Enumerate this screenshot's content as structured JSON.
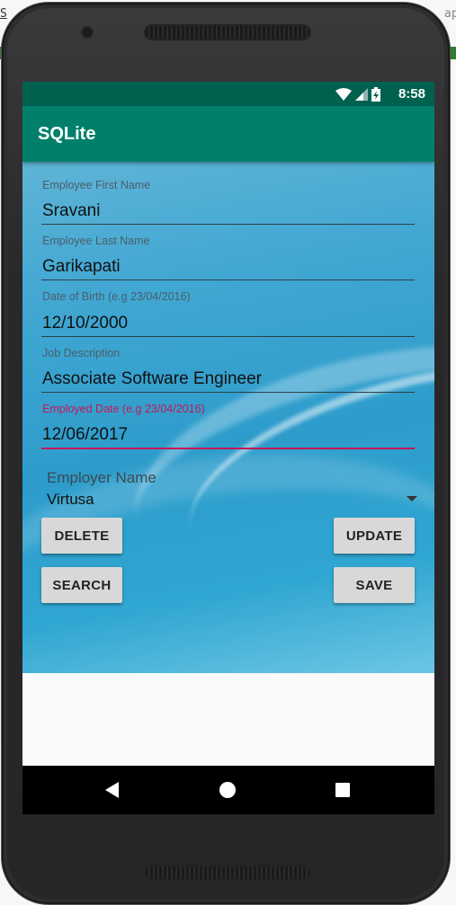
{
  "status_bar": {
    "time": "8:58",
    "icons": [
      "wifi-icon",
      "signal-icon",
      "battery-charging-icon"
    ]
  },
  "app_bar": {
    "title": "SQLite"
  },
  "form": {
    "first_name": {
      "label": "Employee First Name",
      "value": "Sravani"
    },
    "last_name": {
      "label": "Employee Last Name",
      "value": "Garikapati"
    },
    "dob": {
      "label": "Date of Birth (e.g 23/04/2016)",
      "value": "12/10/2000"
    },
    "job": {
      "label": "Job Description",
      "value": "Associate Software Engineer"
    },
    "employed": {
      "label": "Employed Date (e.g 23/04/2016)",
      "value": "12/06/2017"
    },
    "employer": {
      "label": "Employer Name",
      "selected": "Virtusa"
    }
  },
  "buttons": {
    "delete": "DELETE",
    "update": "UPDATE",
    "search": "SEARCH",
    "save": "SAVE"
  },
  "nav": {
    "icons": [
      "back-icon",
      "home-icon",
      "recents-icon"
    ]
  },
  "colors": {
    "primary_dark": "#00614F",
    "primary": "#00806A",
    "accent": "#C2185B"
  }
}
